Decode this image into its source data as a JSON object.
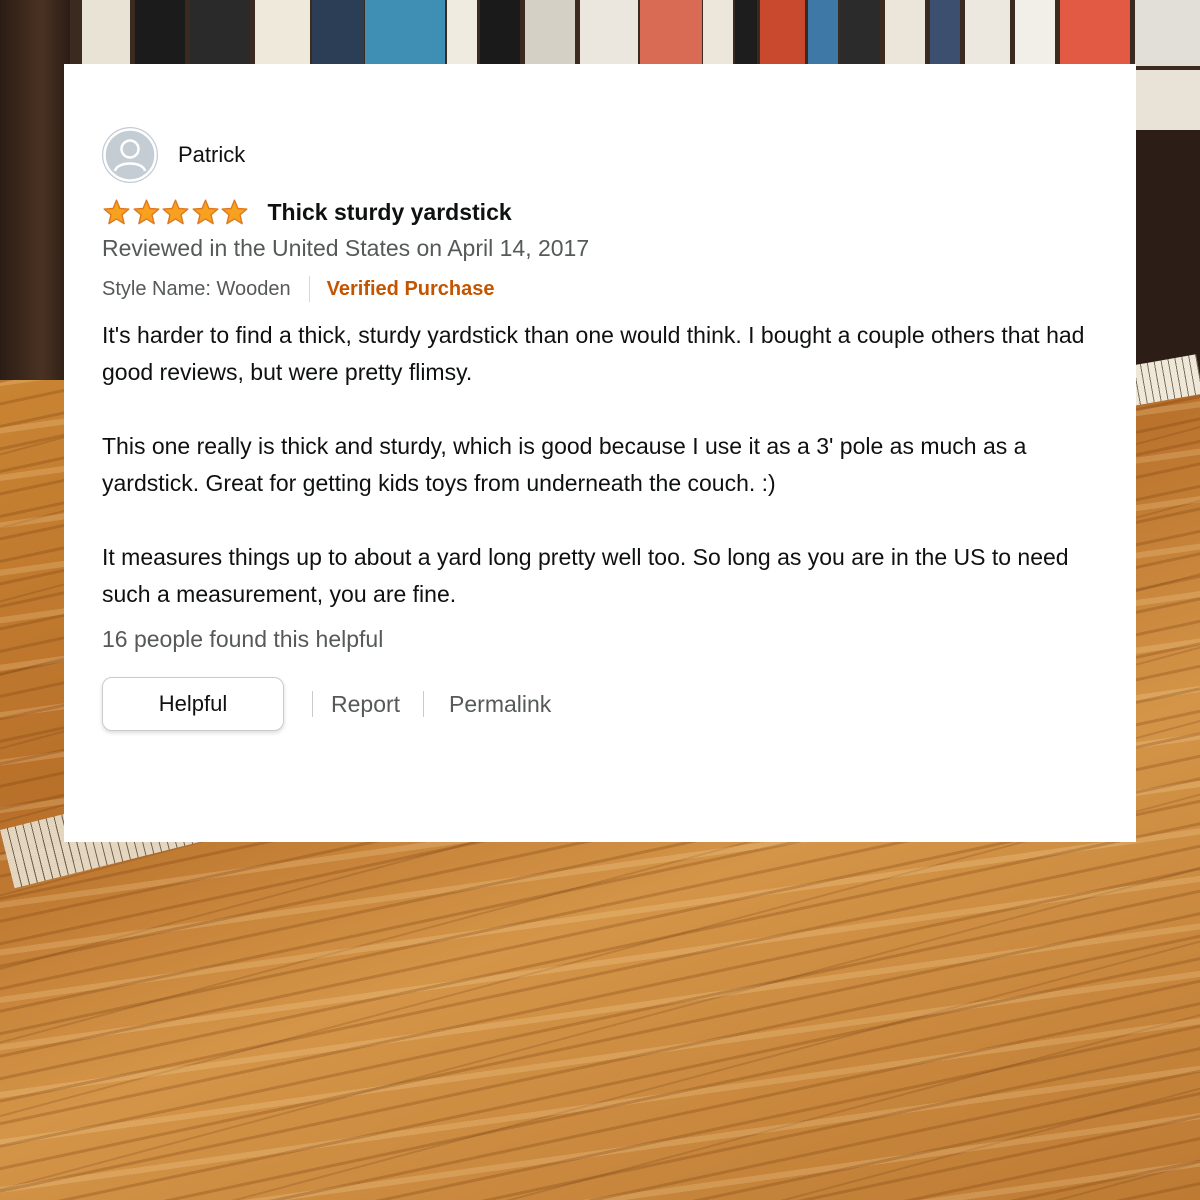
{
  "review": {
    "author": "Patrick",
    "rating": 5,
    "rating_max": 5,
    "title": "Thick sturdy yardstick",
    "reviewed_on": "Reviewed in the United States on April 14, 2017",
    "style_name": "Style Name: Wooden",
    "verified": "Verified Purchase",
    "body": [
      "It's harder to find a thick, sturdy yardstick than one would think. I bought a couple others that had good reviews, but were pretty flimsy.",
      "This one really is thick and sturdy, which is good because I use it as a 3' pole as much as a yardstick. Great for getting kids toys from underneath the couch. :)",
      "It measures things up to about a yard long pretty well too. So long as you are in the US to need such a measurement, you are fine."
    ],
    "helpful_count": "16 people found this helpful"
  },
  "actions": {
    "helpful": "Helpful",
    "report": "Report",
    "permalink": "Permalink"
  },
  "colors": {
    "star": "#f7a11e",
    "verified": "#c45500",
    "secondary_text": "#565959",
    "primary_text": "#0f1111"
  },
  "icons": {
    "avatar": "user-avatar-icon",
    "star": "star-icon"
  }
}
